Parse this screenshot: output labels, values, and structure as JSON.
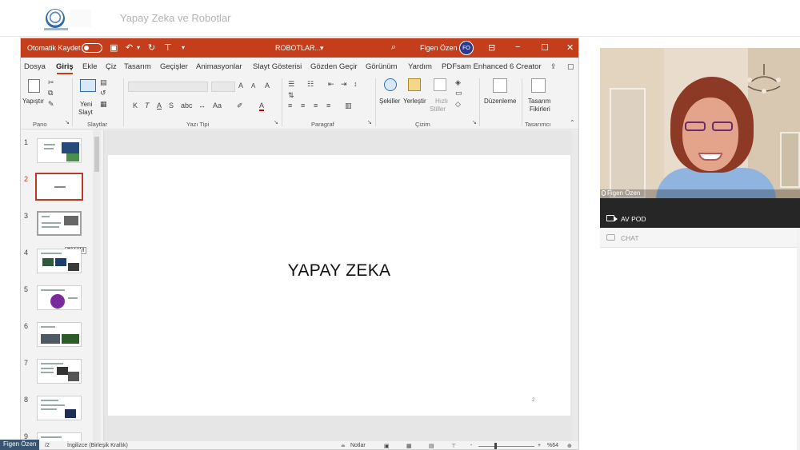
{
  "header": {
    "course_title": "Yapay Zeka ve Robotlar"
  },
  "ppt": {
    "titlebar": {
      "autosave_label": "Otomatik Kaydet",
      "file_name": "ROBOTLAR...",
      "file_dropdown": "▾",
      "user_name": "Figen Özen",
      "user_initials": "FO"
    },
    "menu": [
      "Dosya",
      "Giriş",
      "Ekle",
      "Çiz",
      "Tasarım",
      "Geçişler",
      "Animasyonlar",
      "Slayt Gösterisi",
      "Gözden Geçir",
      "Görünüm",
      "Yardım",
      "PDFsam Enhanced 6 Creator"
    ],
    "ribbon": {
      "paste": "Yapıştır",
      "new_slide_1": "Yeni",
      "new_slide_2": "Slayt",
      "shapes": "Şekiller",
      "arrange": "Yerleştir",
      "quick_styles_1": "Hızlı",
      "quick_styles_2": "Stiller",
      "editing": "Düzenleme",
      "designer_1": "Tasarım",
      "designer_2": "Fikirleri",
      "groups": [
        "Pano",
        "Slaytlar",
        "Yazı Tipi",
        "Paragraf",
        "Çizim",
        "Tasarımcı"
      ],
      "font_buttons": [
        "K",
        "T",
        "A",
        "S"
      ]
    },
    "thumbnails": [
      "1",
      "2",
      "3",
      "4",
      "5",
      "6",
      "7",
      "8",
      "9"
    ],
    "selected_thumbnail": "2",
    "tooltip": "TANIM",
    "slide": {
      "title": "YAPAY ZEKA",
      "number": "2"
    },
    "status": {
      "slide_count": "/2",
      "language": "İngilizce (Birleşik Krallık)",
      "notes": "Notlar",
      "zoom": "%64",
      "zoom_minus": "-",
      "zoom_plus": "+"
    }
  },
  "presenter_tag": "Figen Özen",
  "video": {
    "name": "Figen Özen"
  },
  "pods": {
    "av_pod": "AV POD",
    "chat": "CHAT"
  },
  "colors": {
    "ppt_accent": "#c43e1c",
    "pod_dark": "#262626"
  }
}
